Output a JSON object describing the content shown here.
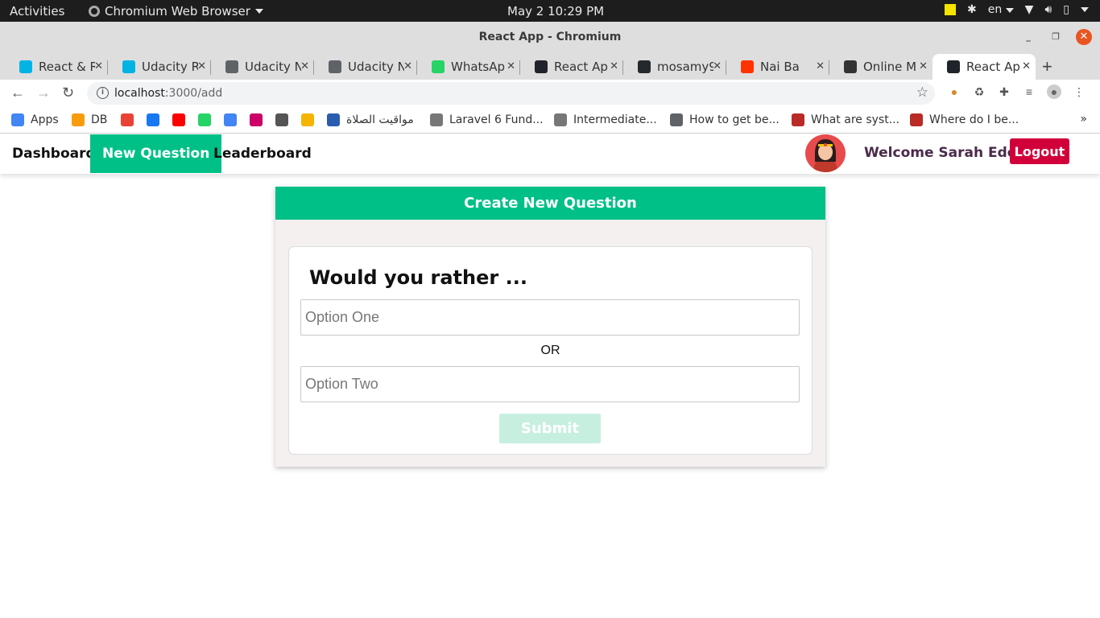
{
  "system": {
    "activities": "Activities",
    "app_menu": "Chromium Web Browser",
    "clock": "May 2  10:29 PM",
    "lang": "en"
  },
  "window": {
    "title": "React App - Chromium"
  },
  "tabs": [
    {
      "label": "React & R",
      "favicon": "udacity-icon",
      "color": "#02b3e4"
    },
    {
      "label": "Udacity R",
      "favicon": "udacity-icon",
      "color": "#02b3e4"
    },
    {
      "label": "Udacity N",
      "favicon": "globe-icon",
      "color": "#5f6368"
    },
    {
      "label": "Udacity N",
      "favicon": "globe-icon",
      "color": "#5f6368"
    },
    {
      "label": "WhatsAp",
      "favicon": "whatsapp-icon",
      "color": "#25d366"
    },
    {
      "label": "React Ap",
      "favicon": "react-icon",
      "color": "#20232a"
    },
    {
      "label": "mosamy9",
      "favicon": "github-icon",
      "color": "#24292e"
    },
    {
      "label": "Nai Ba",
      "favicon": "soundcloud-icon",
      "color": "#ff3300"
    },
    {
      "label": "Online M",
      "favicon": "d-icon",
      "color": "#333333"
    },
    {
      "label": "React Ap",
      "favicon": "react-icon",
      "color": "#20232a"
    }
  ],
  "address_bar": {
    "host": "localhost",
    "path": ":3000/add"
  },
  "bookmarks": [
    {
      "label": "Apps",
      "icon": "apps-grid-icon"
    },
    {
      "label": "DB",
      "icon": "pma-icon"
    },
    {
      "label": "",
      "icon": "google-icon"
    },
    {
      "label": "",
      "icon": "facebook-icon"
    },
    {
      "label": "",
      "icon": "youtube-icon"
    },
    {
      "label": "",
      "icon": "whatsapp-icon"
    },
    {
      "label": "",
      "icon": "translate-icon"
    },
    {
      "label": "",
      "icon": "uva-icon"
    },
    {
      "label": "",
      "icon": "ide-icon"
    },
    {
      "label": "",
      "icon": "chart-icon"
    },
    {
      "label": "مواقيت الصلاة",
      "icon": "pt-icon"
    },
    {
      "label": "Laravel 6 Fund...",
      "icon": "send-icon"
    },
    {
      "label": "Intermediate...",
      "icon": "send-icon"
    },
    {
      "label": "How to get be...",
      "icon": "globe-icon"
    },
    {
      "label": "What are syst...",
      "icon": "quora-icon"
    },
    {
      "label": "Where do I be...",
      "icon": "quora-icon"
    }
  ],
  "nav": {
    "dashboard": "Dashboard",
    "new_question": "New Question",
    "leaderboard": "Leaderboard",
    "welcome": "Welcome Sarah Edo",
    "logout": "Logout"
  },
  "form": {
    "header": "Create New Question",
    "prompt": "Would you rather ...",
    "option_one_placeholder": "Option One",
    "option_one_value": "",
    "separator": "OR",
    "option_two_placeholder": "Option Two",
    "option_two_value": "",
    "submit": "Submit"
  },
  "colors": {
    "accent": "#00c087",
    "logout": "#d1003a",
    "submit_disabled": "#c7efdf"
  }
}
